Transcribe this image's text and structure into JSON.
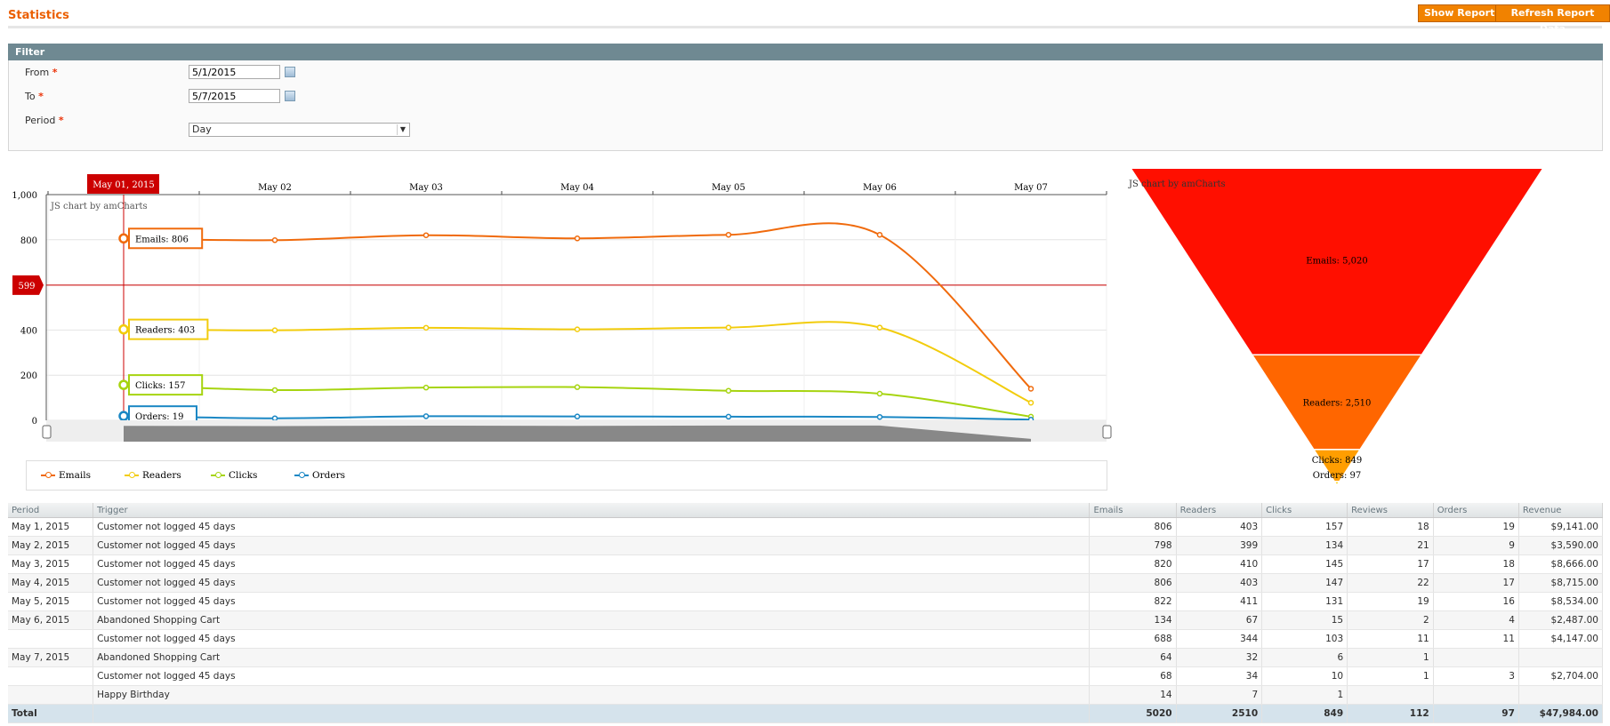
{
  "header": {
    "title": "Statistics",
    "show_report": "Show Report",
    "refresh": "Refresh Report Data"
  },
  "filter": {
    "title": "Filter",
    "from_label": "From",
    "from_value": "5/1/2015",
    "to_label": "To",
    "to_value": "5/7/2015",
    "period_label": "Period",
    "period_value": "Day",
    "required_mark": "*"
  },
  "chart_data": [
    {
      "type": "line",
      "watermark": "JS chart by amCharts",
      "categories": [
        "May 01, 2015",
        "May 02",
        "May 03",
        "May 04",
        "May 05",
        "May 06",
        "May 07"
      ],
      "ylim": [
        0,
        1000
      ],
      "yticks": [
        "1,000",
        "800",
        "600",
        "400",
        "200",
        "0"
      ],
      "cursor_value": "599",
      "series": [
        {
          "name": "Emails",
          "color": "#f06a0c",
          "values": [
            806,
            798,
            820,
            806,
            822,
            822,
            140
          ],
          "balloon": "Emails: 806"
        },
        {
          "name": "Readers",
          "color": "#f2cc0c",
          "values": [
            403,
            399,
            410,
            403,
            411,
            411,
            78
          ],
          "balloon": "Readers: 403"
        },
        {
          "name": "Clicks",
          "color": "#a6d40f",
          "values": [
            157,
            134,
            145,
            147,
            131,
            118,
            16
          ],
          "balloon": "Clicks: 157"
        },
        {
          "name": "Orders",
          "color": "#1a87c4",
          "values": [
            19,
            9,
            18,
            17,
            16,
            15,
            3
          ],
          "balloon": "Orders: 19"
        }
      ]
    },
    {
      "type": "funnel",
      "watermark": "JS chart by amCharts",
      "slices": [
        {
          "label": "Emails: 5,020",
          "value": 5020,
          "color": "#ff0f00"
        },
        {
          "label": "Readers: 2,510",
          "value": 2510,
          "color": "#ff6600"
        },
        {
          "label": "Clicks: 849",
          "value": 849,
          "color": "#ff9e01"
        },
        {
          "label": "Orders: 97",
          "value": 97,
          "color": "#fcd202"
        }
      ]
    }
  ],
  "table": {
    "headers": [
      "Period",
      "Trigger",
      "Emails",
      "Readers",
      "Clicks",
      "Reviews",
      "Orders",
      "Revenue"
    ],
    "rows": [
      [
        "May 1, 2015",
        "Customer not logged 45 days",
        "806",
        "403",
        "157",
        "18",
        "19",
        "$9,141.00"
      ],
      [
        "May 2, 2015",
        "Customer not logged 45 days",
        "798",
        "399",
        "134",
        "21",
        "9",
        "$3,590.00"
      ],
      [
        "May 3, 2015",
        "Customer not logged 45 days",
        "820",
        "410",
        "145",
        "17",
        "18",
        "$8,666.00"
      ],
      [
        "May 4, 2015",
        "Customer not logged 45 days",
        "806",
        "403",
        "147",
        "22",
        "17",
        "$8,715.00"
      ],
      [
        "May 5, 2015",
        "Customer not logged 45 days",
        "822",
        "411",
        "131",
        "19",
        "16",
        "$8,534.00"
      ],
      [
        "May 6, 2015",
        "Abandoned Shopping Cart",
        "134",
        "67",
        "15",
        "2",
        "4",
        "$2,487.00"
      ],
      [
        "",
        "Customer not logged 45 days",
        "688",
        "344",
        "103",
        "11",
        "11",
        "$4,147.00"
      ],
      [
        "May 7, 2015",
        "Abandoned Shopping Cart",
        "64",
        "32",
        "6",
        "1",
        "",
        ""
      ],
      [
        "",
        "Customer not logged 45 days",
        "68",
        "34",
        "10",
        "1",
        "3",
        "$2,704.00"
      ],
      [
        "",
        "Happy Birthday",
        "14",
        "7",
        "1",
        "",
        "",
        ""
      ]
    ],
    "total": [
      "Total",
      "",
      "5020",
      "2510",
      "849",
      "112",
      "97",
      "$47,984.00"
    ]
  }
}
